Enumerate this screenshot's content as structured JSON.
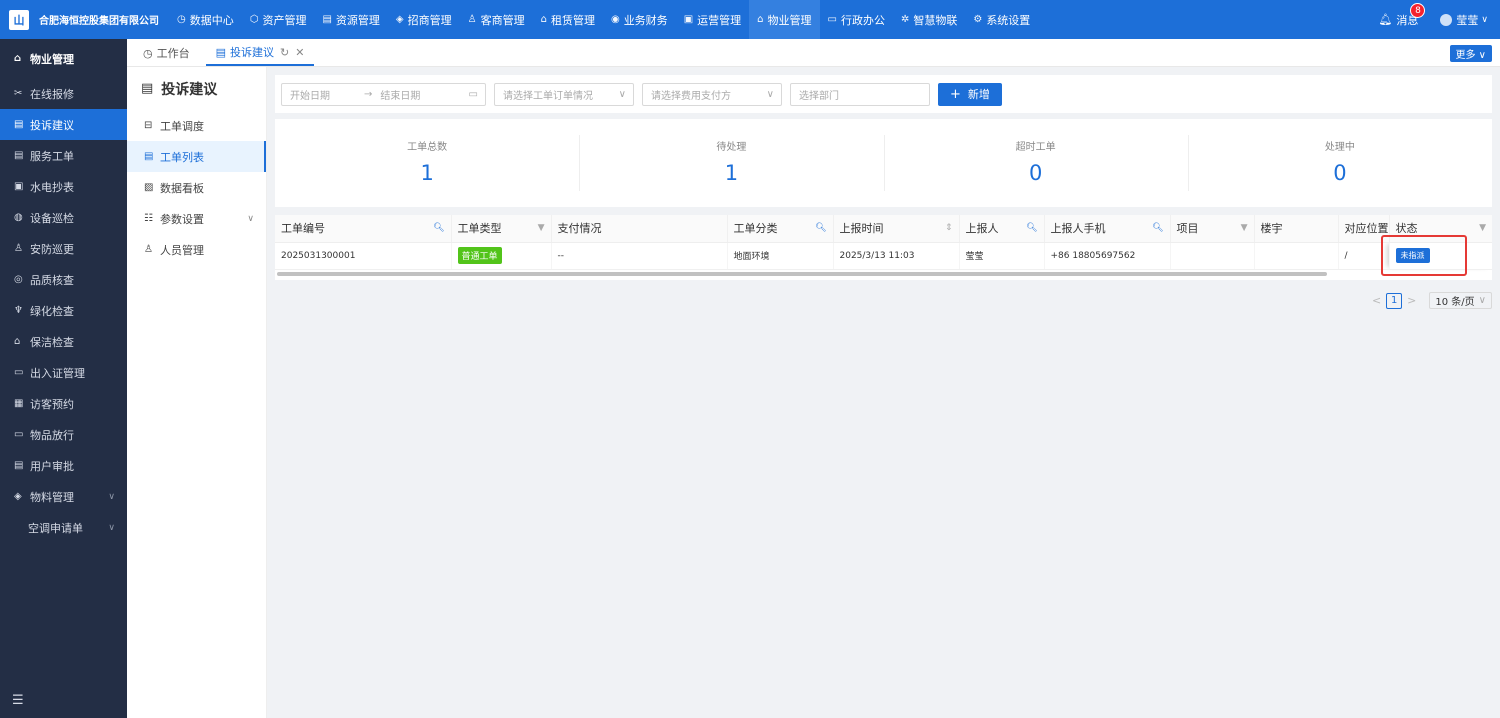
{
  "header": {
    "logo_text": "山",
    "company": "合肥海恒控股集团有限公司",
    "nav": [
      {
        "label": "数据中心",
        "icon": "dashboard-icon",
        "glyph": "◷"
      },
      {
        "label": "资产管理",
        "icon": "cube-icon",
        "glyph": "⬡"
      },
      {
        "label": "资源管理",
        "icon": "building-icon",
        "glyph": "▤"
      },
      {
        "label": "招商管理",
        "icon": "tag-icon",
        "glyph": "◈"
      },
      {
        "label": "客商管理",
        "icon": "users-icon",
        "glyph": "♙"
      },
      {
        "label": "租赁管理",
        "icon": "house-icon",
        "glyph": "⌂"
      },
      {
        "label": "业务财务",
        "icon": "coin-icon",
        "glyph": "◉"
      },
      {
        "label": "运营管理",
        "icon": "chart-icon",
        "glyph": "▣"
      },
      {
        "label": "物业管理",
        "icon": "home-icon",
        "glyph": "⌂",
        "active": true
      },
      {
        "label": "行政办公",
        "icon": "monitor-icon",
        "glyph": "▭"
      },
      {
        "label": "智慧物联",
        "icon": "iot-icon",
        "glyph": "✲"
      },
      {
        "label": "系统设置",
        "icon": "gear-icon",
        "glyph": "⚙"
      }
    ],
    "messages_label": "消息",
    "messages_count": "8",
    "user_name": "莹莹"
  },
  "sidebar": {
    "title": "物业管理",
    "items": [
      {
        "label": "在线报修",
        "glyph": "✂"
      },
      {
        "label": "投诉建议",
        "glyph": "▤",
        "active": true
      },
      {
        "label": "服务工单",
        "glyph": "▤"
      },
      {
        "label": "水电抄表",
        "glyph": "▣"
      },
      {
        "label": "设备巡检",
        "glyph": "◍"
      },
      {
        "label": "安防巡更",
        "glyph": "♙"
      },
      {
        "label": "品质核查",
        "glyph": "◎"
      },
      {
        "label": "绿化检查",
        "glyph": "♆"
      },
      {
        "label": "保洁检查",
        "glyph": "⌂"
      },
      {
        "label": "出入证管理",
        "glyph": "▭"
      },
      {
        "label": "访客预约",
        "glyph": "▦"
      },
      {
        "label": "物品放行",
        "glyph": "▭"
      },
      {
        "label": "用户审批",
        "glyph": "▤"
      },
      {
        "label": "物料管理",
        "glyph": "◈",
        "expandable": true
      }
    ],
    "subitem": "空调申请单",
    "footer_glyph": "☰"
  },
  "tabs": {
    "items": [
      {
        "label": "工作台",
        "glyph": "◷"
      },
      {
        "label": "投诉建议",
        "glyph": "▤",
        "active": true
      }
    ],
    "refresh_glyph": "↻",
    "close_glyph": "✕",
    "more_label": "更多 ∨"
  },
  "subsidebar": {
    "title": "投诉建议",
    "items": [
      {
        "label": "工单调度",
        "glyph": "⊟"
      },
      {
        "label": "工单列表",
        "glyph": "▤",
        "active": true
      },
      {
        "label": "数据看板",
        "glyph": "▨"
      },
      {
        "label": "参数设置",
        "glyph": "☷",
        "expandable": true
      },
      {
        "label": "人员管理",
        "glyph": "♙"
      }
    ]
  },
  "filters": {
    "start_date": "开始日期",
    "arrow": "→",
    "end_date": "结束日期",
    "order_status": "请选择工单订单情况",
    "payer": "请选择费用支付方",
    "department": "选择部门",
    "add_label": "新增"
  },
  "stats": [
    {
      "label": "工单总数",
      "value": "1"
    },
    {
      "label": "待处理",
      "value": "1"
    },
    {
      "label": "超时工单",
      "value": "0"
    },
    {
      "label": "处理中",
      "value": "0"
    }
  ],
  "table": {
    "columns": [
      {
        "label": "工单编号",
        "icon": "search"
      },
      {
        "label": "工单类型",
        "icon": "filter"
      },
      {
        "label": "支付情况",
        "icon": ""
      },
      {
        "label": "工单分类",
        "icon": "search"
      },
      {
        "label": "上报时间",
        "icon": "sort"
      },
      {
        "label": "上报人",
        "icon": "search"
      },
      {
        "label": "上报人手机",
        "icon": "search"
      },
      {
        "label": "项目",
        "icon": "filter"
      },
      {
        "label": "楼宇",
        "icon": ""
      },
      {
        "label": "对应位置",
        "icon": ""
      },
      {
        "label": "状态",
        "icon": "filter"
      }
    ],
    "rows": [
      {
        "id": "2025031300001",
        "type": "普通工单",
        "payment": "--",
        "category": "地面环境",
        "time": "2025/3/13 11:03",
        "reporter": "莹莹",
        "phone": "+86 18805697562",
        "project": "",
        "building": "",
        "location": "/",
        "status": "未指派"
      }
    ]
  },
  "pager": {
    "prev": "<",
    "page": "1",
    "next": ">",
    "page_size": "10 条/页"
  },
  "colors": {
    "primary": "#1d6fd8",
    "sidebar_bg": "#232e45",
    "tag_green": "#52c41a",
    "highlight_red": "#e53935"
  }
}
